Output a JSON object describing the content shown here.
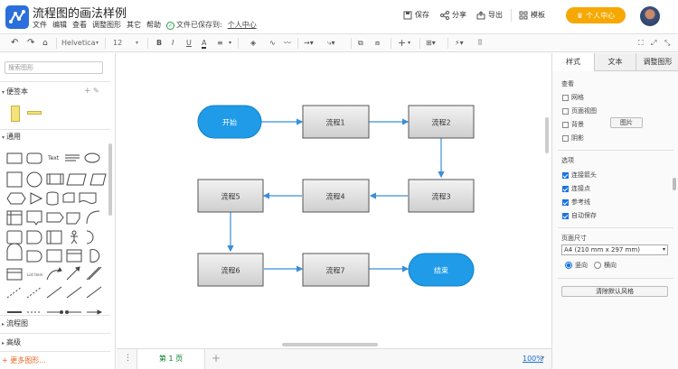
{
  "app": {
    "title": "流程图的画法样例",
    "menu": [
      "文件",
      "编辑",
      "查看",
      "调整图形",
      "其它",
      "帮助"
    ],
    "saved_status": "文件已保存到:",
    "saved_location": "个人中心"
  },
  "header_actions": {
    "save": "保存",
    "share": "分享",
    "export": "导出",
    "template": "模板",
    "personal_center": "个人中心"
  },
  "toolbar": {
    "font_family": "Helvetica",
    "font_size": "12",
    "bold": "B",
    "italic": "I",
    "underline": "U",
    "text_color": "A"
  },
  "left_panel": {
    "search_placeholder": "搜索图形",
    "sections": {
      "notes": "便签本",
      "general": "通用",
      "flowchart": "流程图",
      "advanced": "高级",
      "more": "+ 更多图形..."
    },
    "shape_text": "Text"
  },
  "diagram": {
    "nodes": {
      "start": "开始",
      "p1": "流程1",
      "p2": "流程2",
      "p3": "流程3",
      "p4": "流程4",
      "p5": "流程5",
      "p6": "流程6",
      "p7": "流程7",
      "end": "结束"
    }
  },
  "page_bar": {
    "page_tab": "第 1 页",
    "add_page": "+",
    "zoom": "100%"
  },
  "right_panel": {
    "tabs": [
      "样式",
      "文本",
      "调整图形"
    ],
    "view": {
      "title": "查看",
      "options": [
        {
          "label": "网格",
          "checked": false
        },
        {
          "label": "页面视图",
          "checked": false
        },
        {
          "label": "背景",
          "checked": false
        },
        {
          "label": "阴影",
          "checked": false
        }
      ],
      "image_button": "图片"
    },
    "options_section": {
      "title": "选项",
      "options": [
        {
          "label": "连接箭头",
          "checked": true
        },
        {
          "label": "连接点",
          "checked": true
        },
        {
          "label": "参考线",
          "checked": true
        },
        {
          "label": "自动保存",
          "checked": true
        }
      ]
    },
    "page_size": {
      "title": "页面尺寸",
      "selected": "A4 (210 mm x 297 mm)",
      "portrait": "竖向",
      "landscape": "横向",
      "orientation": "portrait"
    },
    "clear_style_button": "清除默认风格"
  },
  "colors": {
    "terminal_fill": "#1f9be8",
    "process_fill_top": "#f2f2f2",
    "process_fill_bottom": "#cfcfcf",
    "connector": "#3a8fd6",
    "brand": "#2a6fdb",
    "vip": "#f7a800"
  }
}
